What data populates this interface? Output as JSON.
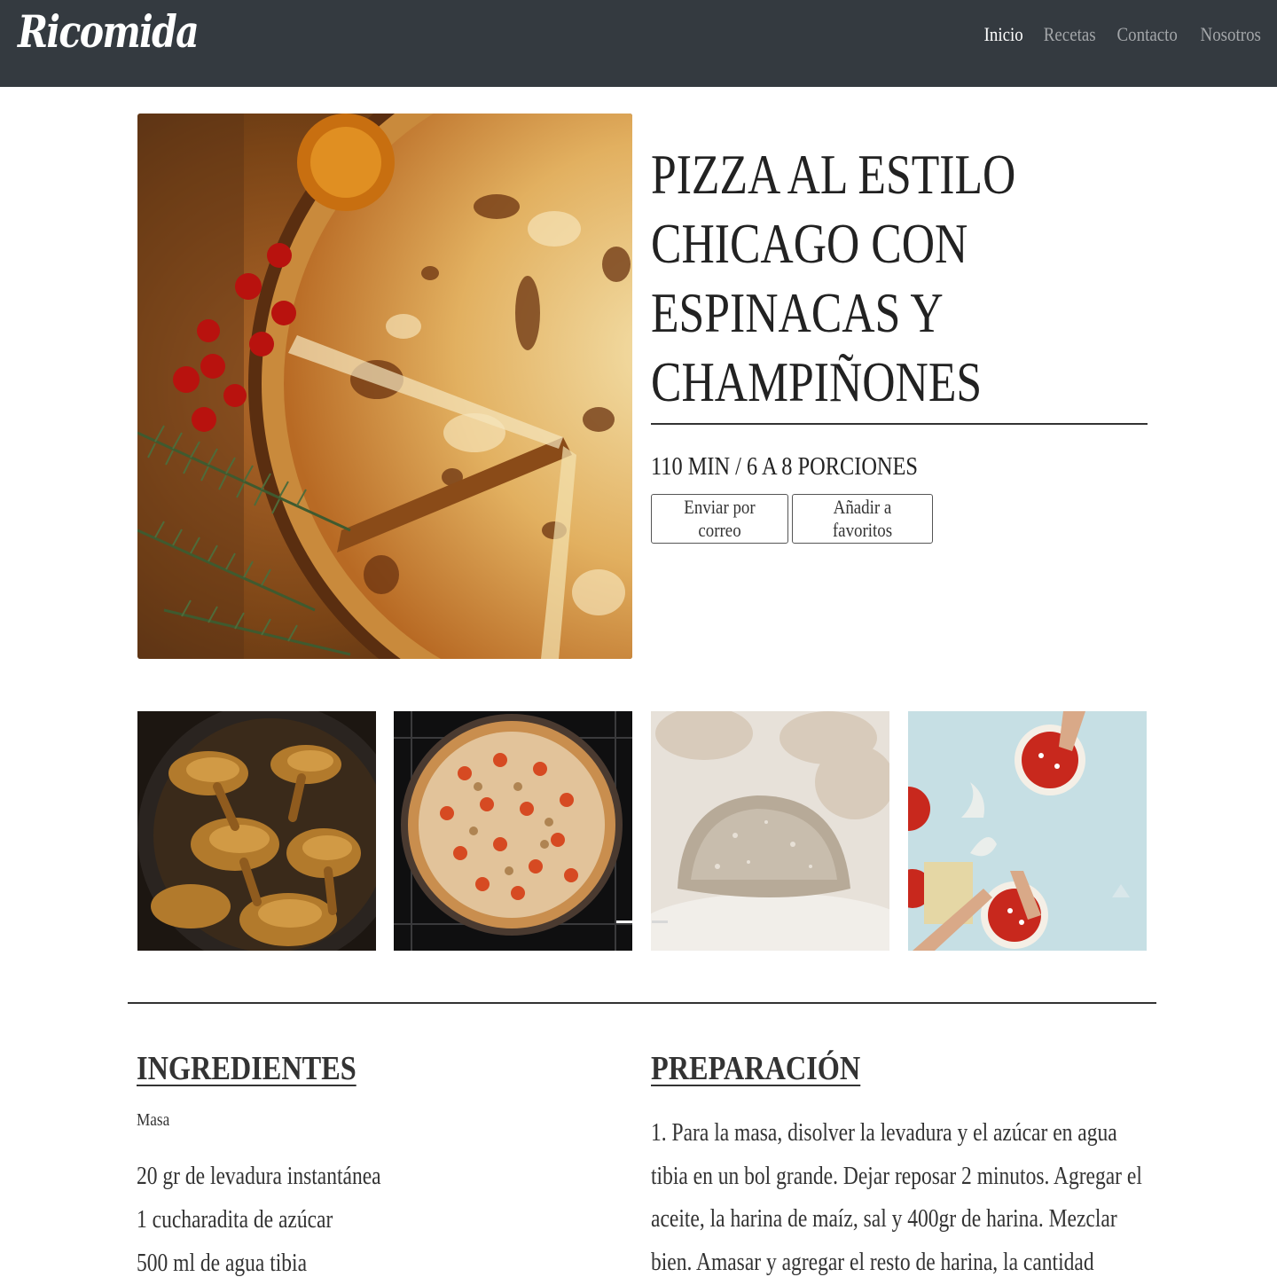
{
  "brand": "Ricomida",
  "nav": {
    "items": [
      {
        "label": "Inicio",
        "active": true
      },
      {
        "label": "Recetas",
        "active": false
      },
      {
        "label": "Contacto",
        "active": false
      },
      {
        "label": "Nosotros",
        "active": false
      }
    ]
  },
  "recipe": {
    "title": "PIZZA AL ESTILO CHICAGO CON ESPINACAS Y CHAMPIÑONES",
    "meta": "110 MIN / 6 A 8 PORCIONES",
    "email_button": "Enviar por correo",
    "favorite_button": "Añadir a favoritos"
  },
  "gallery": {
    "images": [
      "chanterelle-mushrooms-photo",
      "baked-pizza-in-oven-photo",
      "dough-ball-flour-photo",
      "hands-making-pizzas-photo"
    ]
  },
  "ingredients": {
    "heading": "INGREDIENTES",
    "group": "Masa",
    "items": [
      "20 gr de levadura instantánea",
      "1 cucharadita de azúcar",
      "500 ml de agua tibia"
    ]
  },
  "preparation": {
    "heading": "PREPARACIÓN",
    "text": "1. Para la masa, disolver la levadura y el azúcar en agua tibia en un bol grande. Dejar reposar 2 minutos. Agregar el aceite, la harina de maíz, sal y 400gr de harina. Mezclar bien. Amasar y agregar el resto de harina, la cantidad"
  },
  "colors": {
    "navbar": "#343a40",
    "nav_active": "#ffffff",
    "nav_inactive": "#a3a6a9"
  }
}
